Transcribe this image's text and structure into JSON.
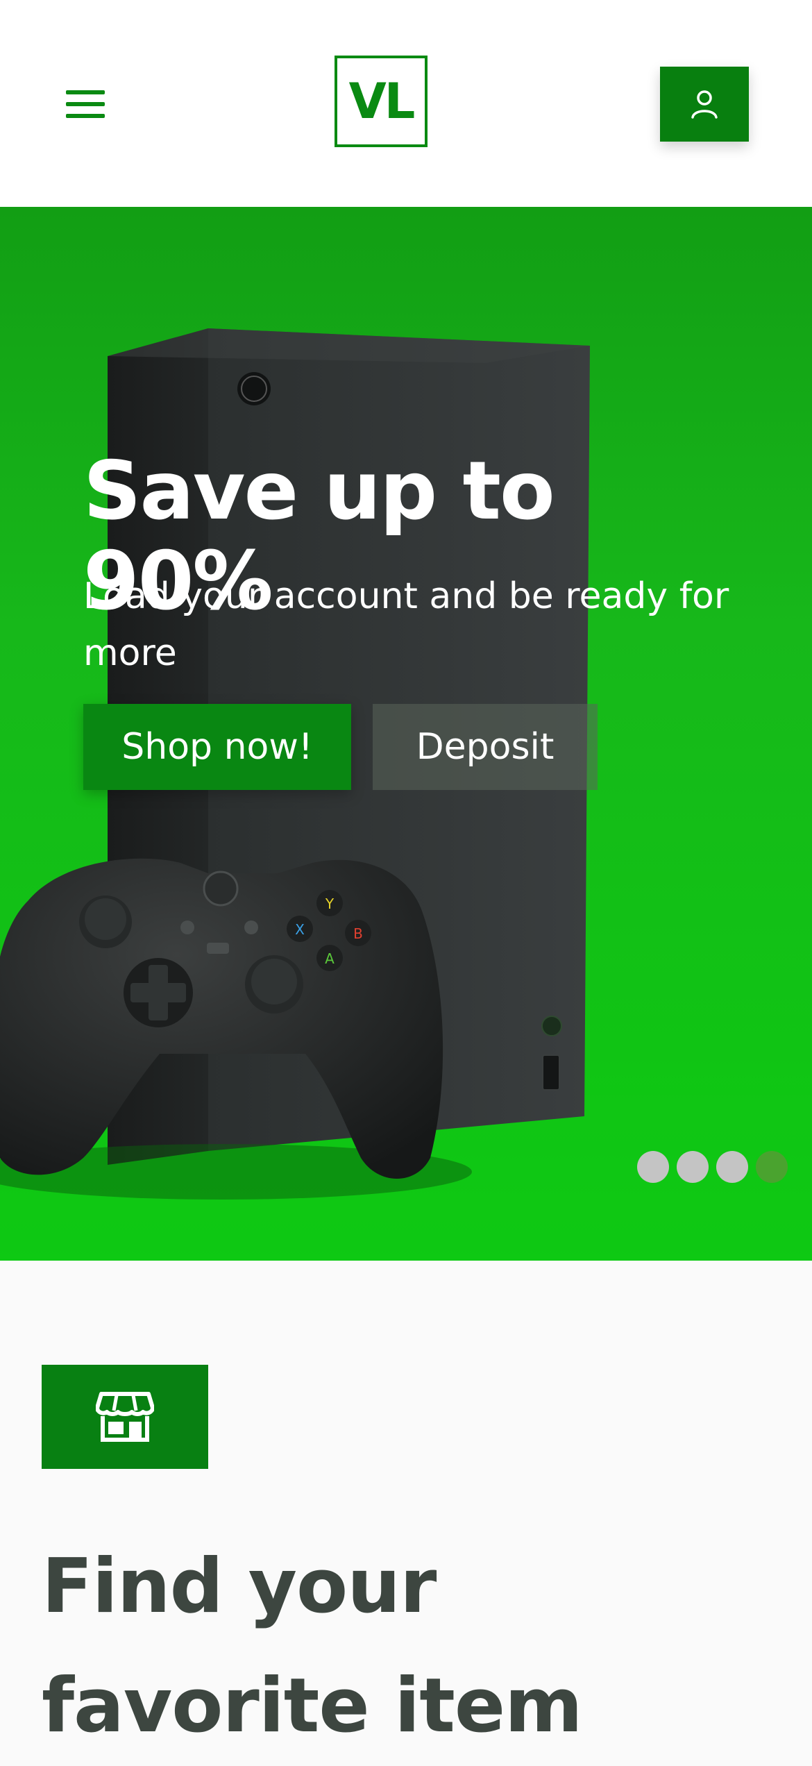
{
  "header": {
    "logo_text": "VL",
    "menu_icon": "hamburger-menu-icon",
    "account_icon": "user-icon",
    "brand_color": "#0a8a12"
  },
  "hero": {
    "title": "Save up to 90%",
    "subtitle": "Load your account and be ready for more",
    "primary_button": "Shop now!",
    "secondary_button": "Deposit",
    "background_color": "#17b81a",
    "carousel": {
      "total_slides": 4,
      "active_slide": 4
    }
  },
  "section": {
    "icon": "store-icon",
    "title": "Find your favorite item"
  }
}
